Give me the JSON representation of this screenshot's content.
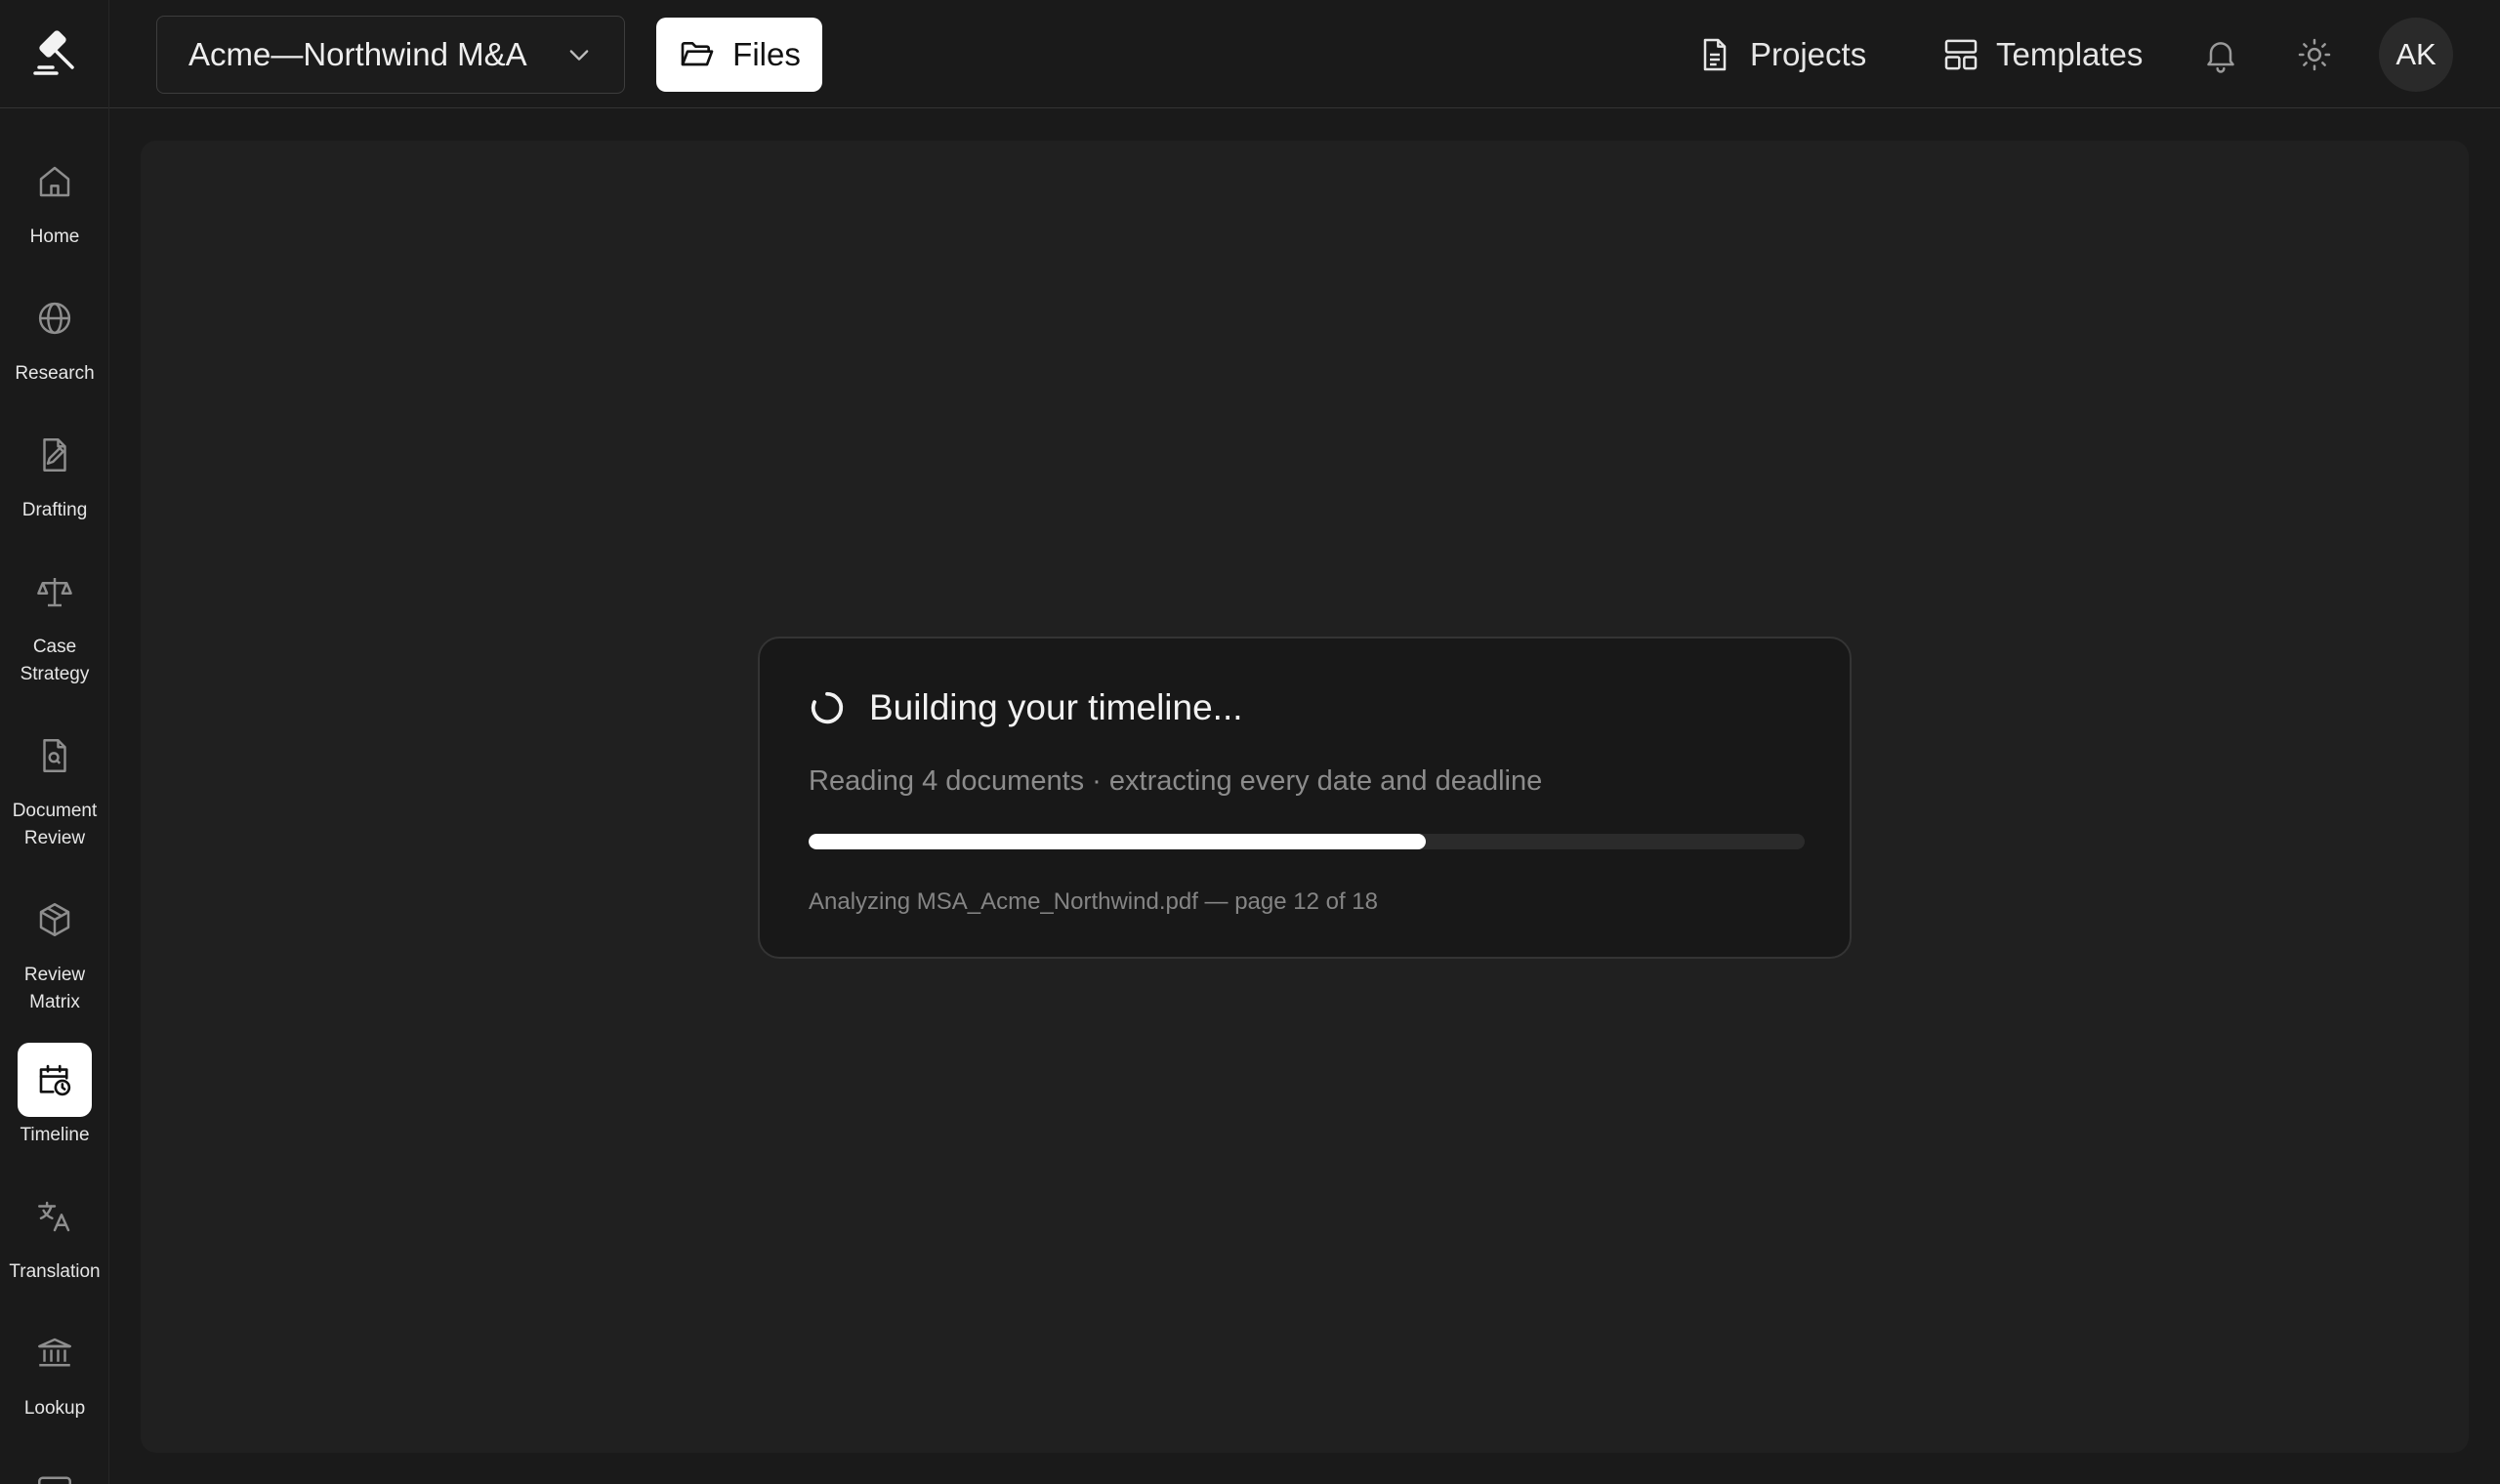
{
  "sidebar": {
    "items": [
      {
        "label": "Home",
        "icon": "home-icon"
      },
      {
        "label": "Research",
        "icon": "globe-icon"
      },
      {
        "label": "Drafting",
        "icon": "pen-document-icon"
      },
      {
        "label": "Case\nStrategy",
        "icon": "scales-icon"
      },
      {
        "label": "Document\nReview",
        "icon": "document-search-icon"
      },
      {
        "label": "Review\nMatrix",
        "icon": "cube-icon"
      },
      {
        "label": "Timeline",
        "icon": "calendar-clock-icon",
        "active": true
      },
      {
        "label": "Translation",
        "icon": "translate-icon"
      },
      {
        "label": "Lookup",
        "icon": "bank-icon"
      }
    ]
  },
  "topbar": {
    "project_name": "Acme—Northwind M&A",
    "files_label": "Files",
    "projects_label": "Projects",
    "templates_label": "Templates",
    "avatar_initials": "AK"
  },
  "progress": {
    "title": "Building your timeline...",
    "subtitle": "Reading 4 documents · extracting every date and deadline",
    "percent": 62,
    "detail": "Analyzing MSA_Acme_Northwind.pdf — page 12 of 18"
  },
  "colors": {
    "background": "#1a1a1a",
    "panel": "#202020",
    "accent": "#ffffff"
  }
}
